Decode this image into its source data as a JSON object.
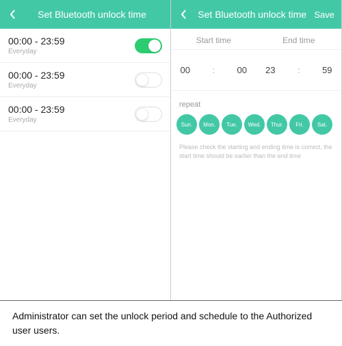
{
  "accent": "#43c8a6",
  "left": {
    "title": "Set Bluetooth unlock time",
    "rows": [
      {
        "time": "00:00 - 23:59",
        "sub": "Everyday",
        "on": true
      },
      {
        "time": "00:00 - 23:59",
        "sub": "Everyday",
        "on": false
      },
      {
        "time": "00:00 - 23:59",
        "sub": "Everyday",
        "on": false
      }
    ]
  },
  "right": {
    "title": "Set Bluetooth unlock time",
    "save_label": "Save",
    "start_label": "Start time",
    "end_label": "End time",
    "start_h": "00",
    "start_m": "00",
    "end_h": "23",
    "end_m": "59",
    "repeat_label": "repeat",
    "days": [
      "Sun.",
      "Mon.",
      "Tue.",
      "Wed.",
      "Thur.",
      "Fri.",
      "Sat."
    ],
    "hint": "Please check the starting and ending time is correct, the start time should be earlier than the end time"
  },
  "caption": "Administrator can set the unlock period and schedule to the Authorized user users."
}
